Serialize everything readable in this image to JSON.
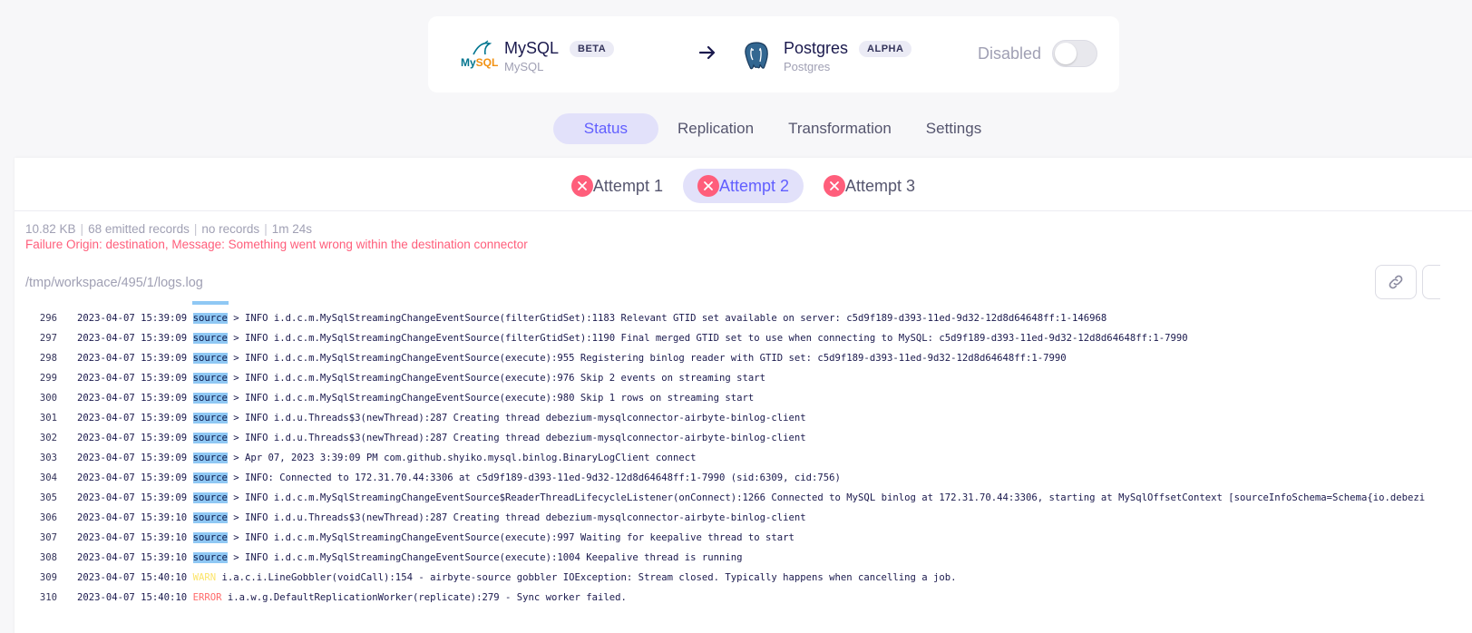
{
  "connection": {
    "source": {
      "name": "MySQL",
      "badge": "BETA",
      "sub": "MySQL"
    },
    "destination": {
      "name": "Postgres",
      "badge": "ALPHA",
      "sub": "Postgres"
    },
    "toggle_label": "Disabled",
    "enabled": false
  },
  "tabs": [
    {
      "label": "Status",
      "active": true
    },
    {
      "label": "Replication",
      "active": false
    },
    {
      "label": "Transformation",
      "active": false
    },
    {
      "label": "Settings",
      "active": false
    }
  ],
  "attempts": [
    {
      "label": "Attempt 1",
      "active": false,
      "status": "failed"
    },
    {
      "label": "Attempt 2",
      "active": true,
      "status": "failed"
    },
    {
      "label": "Attempt 3",
      "active": false,
      "status": "failed"
    }
  ],
  "stats": {
    "size": "10.82 KB",
    "emitted": "68 emitted records",
    "records": "no records",
    "duration": "1m 24s"
  },
  "failure_message": "Failure Origin: destination, Message: Something went wrong within the destination connector",
  "log_path": "/tmp/workspace/495/1/logs.log",
  "colors": {
    "accent": "#615eff",
    "error": "#ff5e7b",
    "highlight": "#8fc8f4",
    "warn": "#fce46a"
  },
  "logs": [
    {
      "n": "296",
      "ts": "2023-04-07 15:39:09",
      "tag": "source",
      "msg": " > INFO i.d.c.m.MySqlStreamingChangeEventSource(filterGtidSet):1183 Relevant GTID set available on server: c5d9f189-d393-11ed-9d32-12d8d64648ff:1-146968"
    },
    {
      "n": "297",
      "ts": "2023-04-07 15:39:09",
      "tag": "source",
      "msg": " > INFO i.d.c.m.MySqlStreamingChangeEventSource(filterGtidSet):1190 Final merged GTID set to use when connecting to MySQL: c5d9f189-d393-11ed-9d32-12d8d64648ff:1-7990"
    },
    {
      "n": "298",
      "ts": "2023-04-07 15:39:09",
      "tag": "source",
      "msg": " > INFO i.d.c.m.MySqlStreamingChangeEventSource(execute):955 Registering binlog reader with GTID set: c5d9f189-d393-11ed-9d32-12d8d64648ff:1-7990"
    },
    {
      "n": "299",
      "ts": "2023-04-07 15:39:09",
      "tag": "source",
      "msg": " > INFO i.d.c.m.MySqlStreamingChangeEventSource(execute):976 Skip 2 events on streaming start"
    },
    {
      "n": "300",
      "ts": "2023-04-07 15:39:09",
      "tag": "source",
      "msg": " > INFO i.d.c.m.MySqlStreamingChangeEventSource(execute):980 Skip 1 rows on streaming start"
    },
    {
      "n": "301",
      "ts": "2023-04-07 15:39:09",
      "tag": "source",
      "msg": " > INFO i.d.u.Threads$3(newThread):287 Creating thread debezium-mysqlconnector-airbyte-binlog-client"
    },
    {
      "n": "302",
      "ts": "2023-04-07 15:39:09",
      "tag": "source",
      "msg": " > INFO i.d.u.Threads$3(newThread):287 Creating thread debezium-mysqlconnector-airbyte-binlog-client"
    },
    {
      "n": "303",
      "ts": "2023-04-07 15:39:09",
      "tag": "source",
      "msg": " > Apr 07, 2023 3:39:09 PM com.github.shyiko.mysql.binlog.BinaryLogClient connect"
    },
    {
      "n": "304",
      "ts": "2023-04-07 15:39:09",
      "tag": "source",
      "msg": " > INFO: Connected to 172.31.70.44:3306 at c5d9f189-d393-11ed-9d32-12d8d64648ff:1-7990 (sid:6309, cid:756)"
    },
    {
      "n": "305",
      "ts": "2023-04-07 15:39:09",
      "tag": "source",
      "msg": " > INFO i.d.c.m.MySqlStreamingChangeEventSource$ReaderThreadLifecycleListener(onConnect):1266 Connected to MySQL binlog at 172.31.70.44:3306, starting at MySqlOffsetContext [sourceInfoSchema=Schema{io.debezi"
    },
    {
      "n": "306",
      "ts": "2023-04-07 15:39:10",
      "tag": "source",
      "msg": " > INFO i.d.u.Threads$3(newThread):287 Creating thread debezium-mysqlconnector-airbyte-binlog-client"
    },
    {
      "n": "307",
      "ts": "2023-04-07 15:39:10",
      "tag": "source",
      "msg": " > INFO i.d.c.m.MySqlStreamingChangeEventSource(execute):997 Waiting for keepalive thread to start"
    },
    {
      "n": "308",
      "ts": "2023-04-07 15:39:10",
      "tag": "source",
      "msg": " > INFO i.d.c.m.MySqlStreamingChangeEventSource(execute):1004 Keepalive thread is running"
    },
    {
      "n": "309",
      "ts": "2023-04-07 15:40:10",
      "level": "WARN",
      "msg": " i.a.c.i.LineGobbler(voidCall):154 - airbyte-source gobbler IOException: Stream closed. Typically happens when cancelling a job."
    },
    {
      "n": "310",
      "ts": "2023-04-07 15:40:10",
      "level": "ERROR",
      "msg": " i.a.w.g.DefaultReplicationWorker(replicate):279 - Sync worker failed."
    }
  ]
}
